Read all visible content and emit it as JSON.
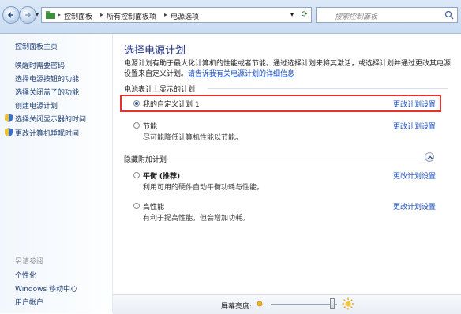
{
  "breadcrumb": [
    "控制面板",
    "所有控制面板项",
    "电源选项"
  ],
  "search": {
    "placeholder": "搜索控制面板"
  },
  "sidebar": {
    "home": "控制面板主页",
    "items": [
      "唤醒时需要密码",
      "选择电源按钮的功能",
      "选择关闭盖子的功能",
      "创建电源计划",
      "选择关闭显示器的时间",
      "更改计算机睡眠时间"
    ],
    "see_also": "另请参阅",
    "see_items": [
      "个性化",
      "Windows 移动中心",
      "用户帐户"
    ]
  },
  "main": {
    "title": "选择电源计划",
    "desc": "电源计划有助于最大化计算机的性能或者节能。通过选择计划来将其激活，或选择计划并通过更改其电源设置来自定义计划。",
    "desc_link": "请告诉我有关电源计划的详细信息",
    "group1": "电池表计上显示的计划",
    "group2": "隐藏附加计划",
    "plans": [
      {
        "name": "我的自定义计划 1",
        "desc": "",
        "selected": true,
        "link": "更改计划设置"
      },
      {
        "name": "节能",
        "desc": "尽可能降低计算机性能以节能。",
        "selected": false,
        "link": "更改计划设置"
      },
      {
        "name": "平衡",
        "tag": "(推荐)",
        "desc": "利用可用的硬件自动平衡功耗与性能。",
        "selected": false,
        "link": "更改计划设置"
      },
      {
        "name": "高性能",
        "desc": "有利于提高性能，但会增加功耗。",
        "selected": false,
        "link": "更改计划设置"
      }
    ]
  },
  "bottom": {
    "brightness_label": "屏幕亮度:",
    "brightness_level": 0.93
  },
  "colors": {
    "highlight_box": "#e5312b",
    "link": "#1a4fbd",
    "title": "#1e3287"
  }
}
